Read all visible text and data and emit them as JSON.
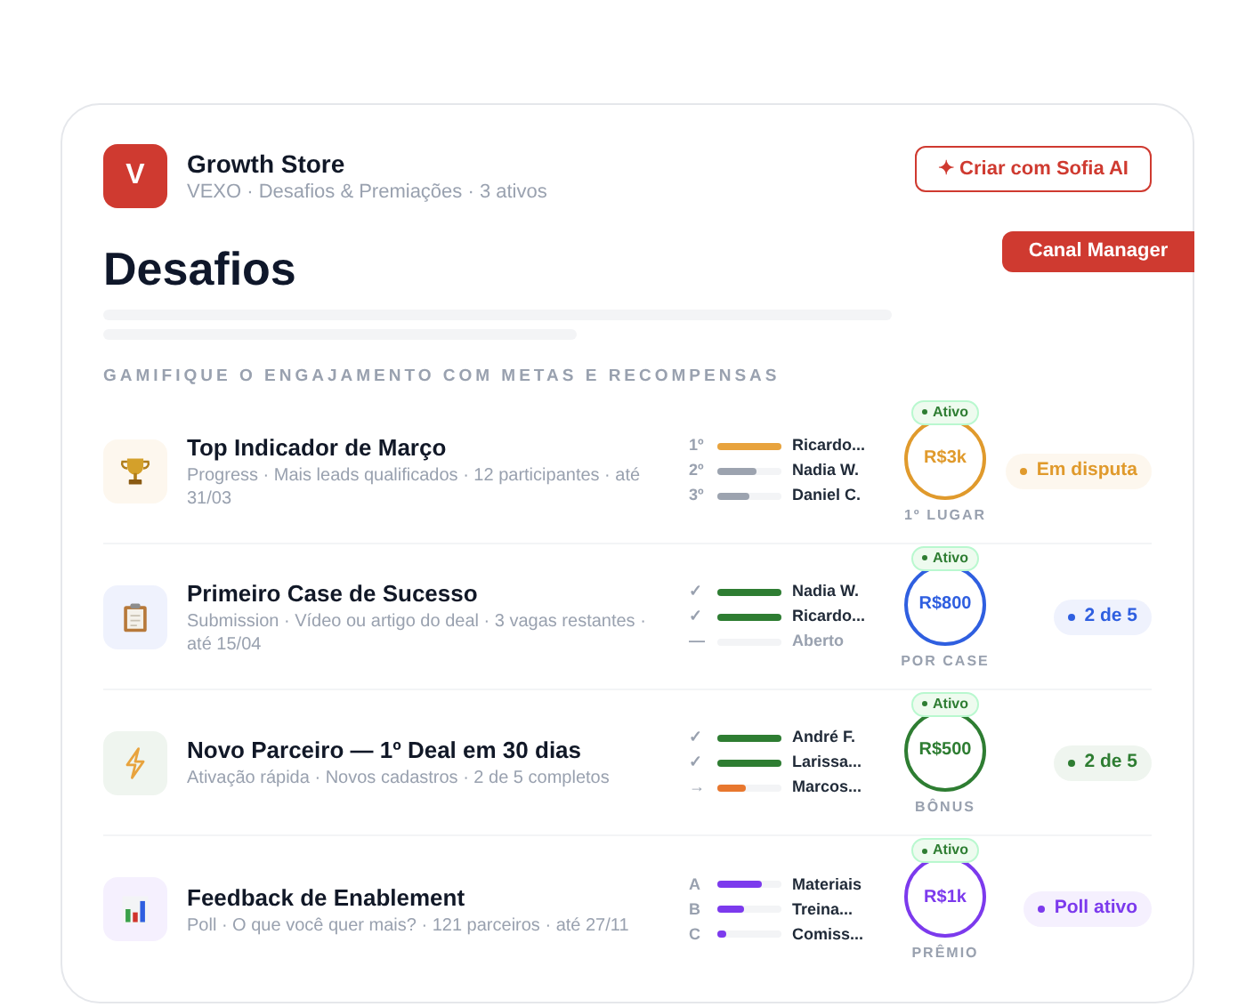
{
  "header": {
    "logo": "V",
    "title": "Growth Store",
    "subtitle": "VEXO · Desafios & Premiações · 3 ativos",
    "action": "✦ Criar com Sofia AI"
  },
  "page_title": "Desafios",
  "side_tab": "Canal Manager",
  "section_label": "GAMIFIQUE O ENGAJAMENTO COM METAS E RECOMPENSAS",
  "challenges": [
    {
      "kind": "ranking",
      "color": "#e09a2c",
      "title": "Top Indicador de Março",
      "meta": "Progress · Mais leads qualificados · 12 participantes · até 31/03",
      "entries": [
        {
          "mark": "1º",
          "name": "Ricardo...",
          "level": 1,
          "color": "#e8a33d",
          "pending": false
        },
        {
          "mark": "2º",
          "name": "Nadia W.",
          "level": 0.6,
          "color": "#9ca3af",
          "pending": false
        },
        {
          "mark": "3º",
          "name": "Daniel C.",
          "level": 0.5,
          "color": "#9ca3af",
          "pending": false
        }
      ],
      "prize": {
        "badge": "Ativo",
        "amount": "R$3k",
        "caption": "1º LUGAR"
      },
      "status": "Em disputa"
    },
    {
      "kind": "submission",
      "color": "#2f5fe0",
      "title": "Primeiro Case de Sucesso",
      "meta": "Submission · Vídeo ou artigo do deal · 3 vagas restantes · até 15/04",
      "entries": [
        {
          "mark": "✓",
          "name": "Nadia W.",
          "level": 1,
          "color": "#2e7d32",
          "pending": false
        },
        {
          "mark": "✓",
          "name": "Ricardo...",
          "level": 1,
          "color": "#2e7d32",
          "pending": false
        },
        {
          "mark": "—",
          "name": "Aberto",
          "pending": true
        }
      ],
      "prize": {
        "badge": "Ativo",
        "amount": "R$800",
        "caption": "POR CASE"
      },
      "status": "2 de 5"
    },
    {
      "kind": "onboarding",
      "color": "#2e7d32",
      "title": "Novo Parceiro — 1º Deal em 30 dias",
      "meta": "Ativação rápida · Novos cadastros · 2 de 5 completos",
      "entries": [
        {
          "mark": "✓",
          "name": "André F.",
          "level": 1,
          "color": "#2e7d32",
          "pending": false
        },
        {
          "mark": "✓",
          "name": "Larissa...",
          "level": 1,
          "color": "#2e7d32",
          "pending": false
        },
        {
          "mark": "→",
          "name": "Marcos...",
          "level": 0.45,
          "color": "#e8772e",
          "pending": false
        }
      ],
      "prize": {
        "badge": "Ativo",
        "amount": "R$500",
        "caption": "BÔNUS"
      },
      "status": "2 de 5"
    },
    {
      "kind": "poll",
      "color": "#7c3aed",
      "title": "Feedback de Enablement",
      "meta": "Poll · O que você quer mais? · 121 parceiros · até 27/11",
      "entries": [
        {
          "mark": "A",
          "name": "Materiais",
          "level": 0.7,
          "color": "#7c3aed",
          "pending": false
        },
        {
          "mark": "B",
          "name": "Treina...",
          "level": 0.42,
          "color": "#7c3aed",
          "pending": false
        },
        {
          "mark": "C",
          "name": "Comiss...",
          "level": 0.15,
          "color": "#7c3aed",
          "pending": false
        }
      ],
      "prize": {
        "badge": "Ativo",
        "amount": "R$1k",
        "caption": "PRÊMIO"
      },
      "status": "Poll ativo"
    }
  ]
}
